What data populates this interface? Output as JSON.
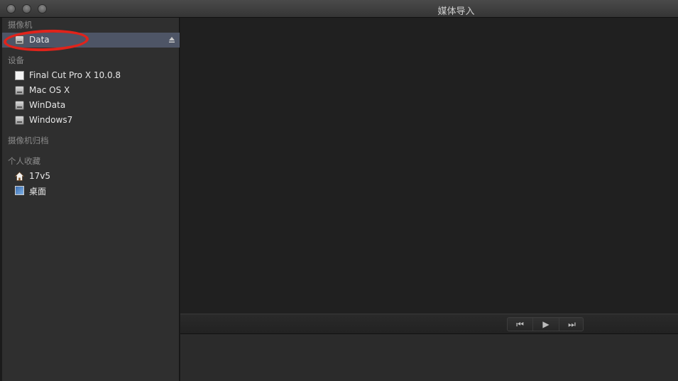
{
  "window": {
    "title": "媒体导入"
  },
  "sidebar": {
    "sections": [
      {
        "header": "摄像机",
        "items": [
          {
            "label": "Data",
            "icon": "disk-icon",
            "selected": true,
            "eject": true
          }
        ]
      },
      {
        "header": "设备",
        "items": [
          {
            "label": "Final Cut Pro X 10.0.8",
            "icon": "document-icon"
          },
          {
            "label": "Mac OS X",
            "icon": "disk-icon"
          },
          {
            "label": "WinData",
            "icon": "disk-icon"
          },
          {
            "label": "Windows7",
            "icon": "disk-icon"
          }
        ]
      },
      {
        "header": "摄像机归档",
        "items": []
      },
      {
        "header": "个人收藏",
        "items": [
          {
            "label": "17v5",
            "icon": "home-icon"
          },
          {
            "label": "桌面",
            "icon": "desktop-icon"
          }
        ]
      }
    ]
  },
  "transport": {
    "prev_icon": "⏮",
    "play_icon": "▶",
    "next_icon": "⏭"
  },
  "colors": {
    "annotation": "#e0231b",
    "selection": "#4e5566"
  }
}
